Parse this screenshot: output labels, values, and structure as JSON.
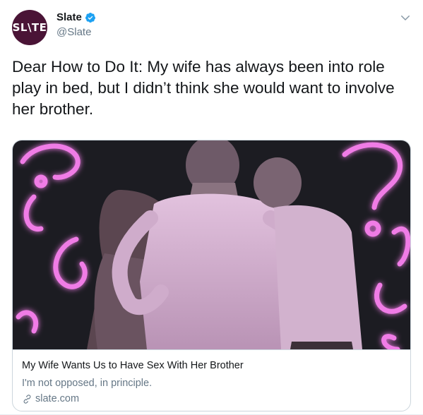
{
  "account": {
    "avatar_text": "SL\\TE",
    "display_name": "Slate",
    "handle": "@Slate",
    "verified": true,
    "avatar_color": "#4a1436",
    "verified_color": "#1da1f2"
  },
  "tweet": {
    "text": "Dear How to Do It: My wife has always been into role play in bed, but I didn’t think she would want to involve her brother."
  },
  "card": {
    "title": "My Wife Wants Us to Have Sex With Her Brother",
    "description": "I'm not opposed, in principle.",
    "domain": "slate.com",
    "image_icon": "three-people-embracing-with-neon-question-marks",
    "neon_color": "#e85ad8",
    "image_background": "#1c1c22"
  },
  "icons": {
    "verified": "verified-badge-icon",
    "caret": "chevron-down-icon",
    "link": "link-icon"
  }
}
